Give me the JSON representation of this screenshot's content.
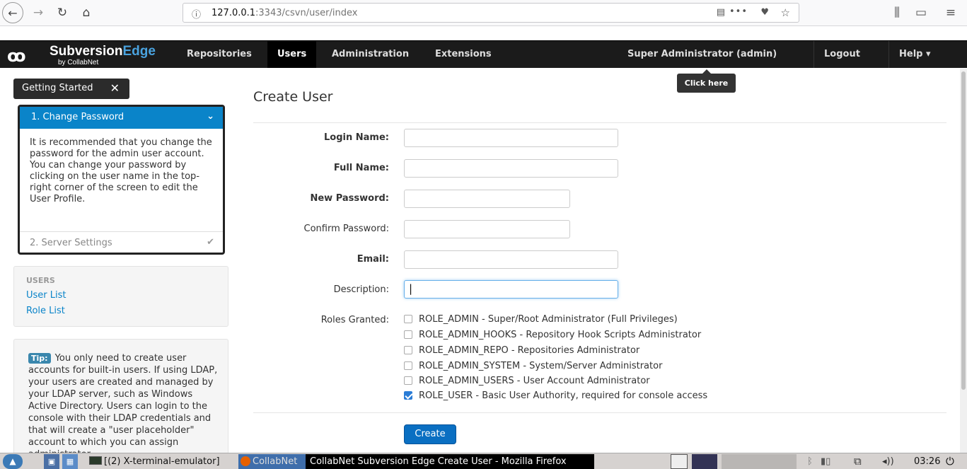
{
  "browser": {
    "url_host": "127.0.0.1",
    "url_rest": ":3343/csvn/user/index",
    "info_icon": "info-icon"
  },
  "navbar": {
    "logo_main": "Subversion",
    "logo_accent": "Edge",
    "logo_sub": "by CollabNet",
    "items": [
      "Repositories",
      "Users",
      "Administration",
      "Extensions"
    ],
    "user": "Super Administrator (admin)",
    "logout": "Logout",
    "help": "Help ▾",
    "tooltip": "Click here"
  },
  "sidebar": {
    "getting_started": "Getting Started",
    "step1_title": "1. Change Password",
    "step1_body": "It is recommended that you change the password for the admin user account.\nYou can change your password by clicking on the user name in the top-right corner of the screen to edit the User Profile.",
    "step2_title": "2. Server Settings",
    "users_heading": "USERS",
    "user_list": "User List",
    "role_list": "Role List",
    "tip_badge": "Tip:",
    "tip_text": " You only need to create user accounts for built-in users. If using LDAP, your users are created and managed by your LDAP server, such as Windows Active Directory. Users can login to the console with their LDAP credentials and that will create a \"user placeholder\" account to which you can assign administrator"
  },
  "form": {
    "title": "Create User",
    "login_label": "Login Name:",
    "fullname_label": "Full Name:",
    "newpw_label": "New Password:",
    "confirmpw_label": "Confirm Password:",
    "email_label": "Email:",
    "desc_label": "Description:",
    "roles_label": "Roles Granted:",
    "login_value": "",
    "fullname_value": "",
    "newpw_value": "",
    "confirmpw_value": "",
    "email_value": "",
    "desc_value": "|",
    "roles": [
      {
        "label": "ROLE_ADMIN - Super/Root Administrator (Full Privileges)",
        "checked": false
      },
      {
        "label": "ROLE_ADMIN_HOOKS - Repository Hook Scripts Administrator",
        "checked": false
      },
      {
        "label": "ROLE_ADMIN_REPO - Repositories Administrator",
        "checked": false
      },
      {
        "label": "ROLE_ADMIN_SYSTEM - System/Server Administrator",
        "checked": false
      },
      {
        "label": "ROLE_ADMIN_USERS - User Account Administrator",
        "checked": false
      },
      {
        "label": "ROLE_USER - Basic User Authority, required for console access",
        "checked": true
      }
    ],
    "create_button": "Create"
  },
  "taskbar": {
    "terminal": "[(2) X-terminal-emulator]",
    "ff_inactive": "CollabNet",
    "ff_active": "CollabNet Subversion Edge Create User - Mozilla Firefox",
    "clock": "03:26"
  },
  "colors": {
    "accent": "#0a84c9",
    "navbar": "#1b1b1b",
    "button": "#0a6fc2"
  }
}
